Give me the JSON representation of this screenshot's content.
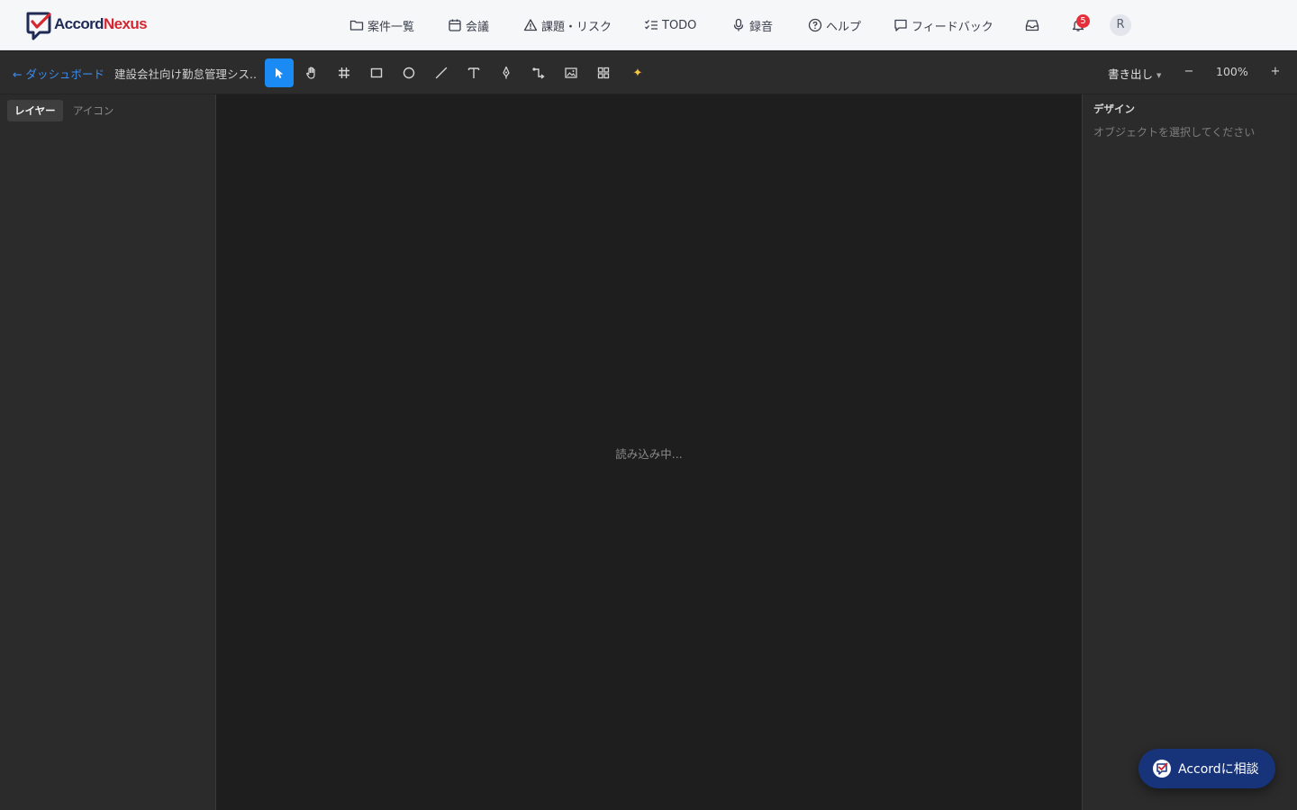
{
  "app": {
    "logo": {
      "text_main": "Accord",
      "text_accent": "Nexus"
    }
  },
  "nav": {
    "items": [
      {
        "label": "案件一覧",
        "icon": "folder-icon"
      },
      {
        "label": "会議",
        "icon": "calendar-icon"
      },
      {
        "label": "課題・リスク",
        "icon": "warning-icon"
      },
      {
        "label": "TODO",
        "icon": "checklist-icon"
      },
      {
        "label": "録音",
        "icon": "microphone-icon"
      },
      {
        "label": "ヘルプ",
        "icon": "help-icon"
      },
      {
        "label": "フィードバック",
        "icon": "message-icon"
      }
    ],
    "inbox_icon": "inbox-icon",
    "notifications": {
      "icon": "bell-icon",
      "count": "5"
    },
    "avatar_initial": "R"
  },
  "toolbar": {
    "back_label": "← ダッシュボード",
    "document_title": "建設会社向け勤怠管理シス...",
    "tools": [
      {
        "name": "select-tool",
        "icon": "cursor-icon",
        "active": true
      },
      {
        "name": "hand-tool",
        "icon": "hand-icon",
        "active": false
      },
      {
        "name": "frame-tool",
        "icon": "hash-icon",
        "active": false
      },
      {
        "name": "rectangle-tool",
        "icon": "rectangle-icon",
        "active": false
      },
      {
        "name": "ellipse-tool",
        "icon": "circle-icon",
        "active": false
      },
      {
        "name": "line-tool",
        "icon": "line-icon",
        "active": false
      },
      {
        "name": "text-tool",
        "icon": "text-icon",
        "active": false
      },
      {
        "name": "pen-tool",
        "icon": "pen-icon",
        "active": false
      },
      {
        "name": "connector-tool",
        "icon": "connector-icon",
        "active": false
      },
      {
        "name": "image-tool",
        "icon": "image-icon",
        "active": false
      },
      {
        "name": "components-tool",
        "icon": "grid-icon",
        "active": false
      },
      {
        "name": "ai-tool",
        "icon": "sparkles-icon",
        "active": false
      }
    ],
    "export_label": "書き出し",
    "zoom_out": "−",
    "zoom_level": "100%",
    "zoom_in": "+"
  },
  "left_panel": {
    "tabs": [
      {
        "label": "レイヤー",
        "active": true
      },
      {
        "label": "アイコン",
        "active": false
      }
    ]
  },
  "canvas": {
    "loading_text": "読み込み中..."
  },
  "right_panel": {
    "heading": "デザイン",
    "hint": "オブジェクトを選択してください"
  },
  "chat": {
    "label": "Accordに相談"
  },
  "colors": {
    "accent_blue": "#1a8bf5",
    "brand_navy": "#1f2a55",
    "brand_red": "#d6262f",
    "canvas_bg": "#1e1e1e",
    "panel_bg": "#2b2b2b",
    "badge_red": "#e5303b",
    "chat_button_bg": "#17347a"
  }
}
